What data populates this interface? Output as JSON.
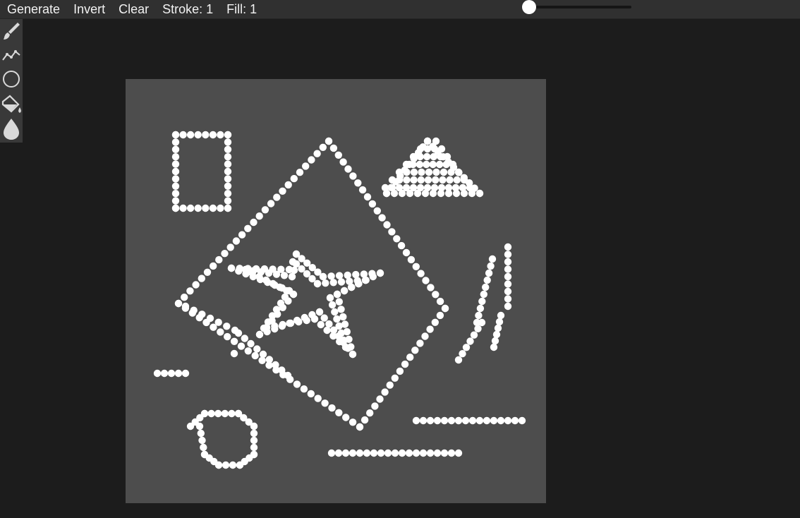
{
  "menu": {
    "generate": "Generate",
    "invert": "Invert",
    "clear": "Clear",
    "stroke": "Stroke: 1",
    "fill": "Fill: 1"
  },
  "slider": {
    "value": 0.0
  },
  "tools": [
    {
      "icon": "brush-icon"
    },
    {
      "icon": "polyline-icon"
    },
    {
      "icon": "circle-icon"
    },
    {
      "icon": "paint-bucket-icon"
    },
    {
      "icon": "droplet-icon"
    }
  ],
  "colors": {
    "background": "#1c1c1c",
    "menubar": "#303030",
    "toolbar": "#393939",
    "canvas": "#4d4d4d",
    "dot": "#ffffff",
    "icon": "#d9d9d9"
  }
}
